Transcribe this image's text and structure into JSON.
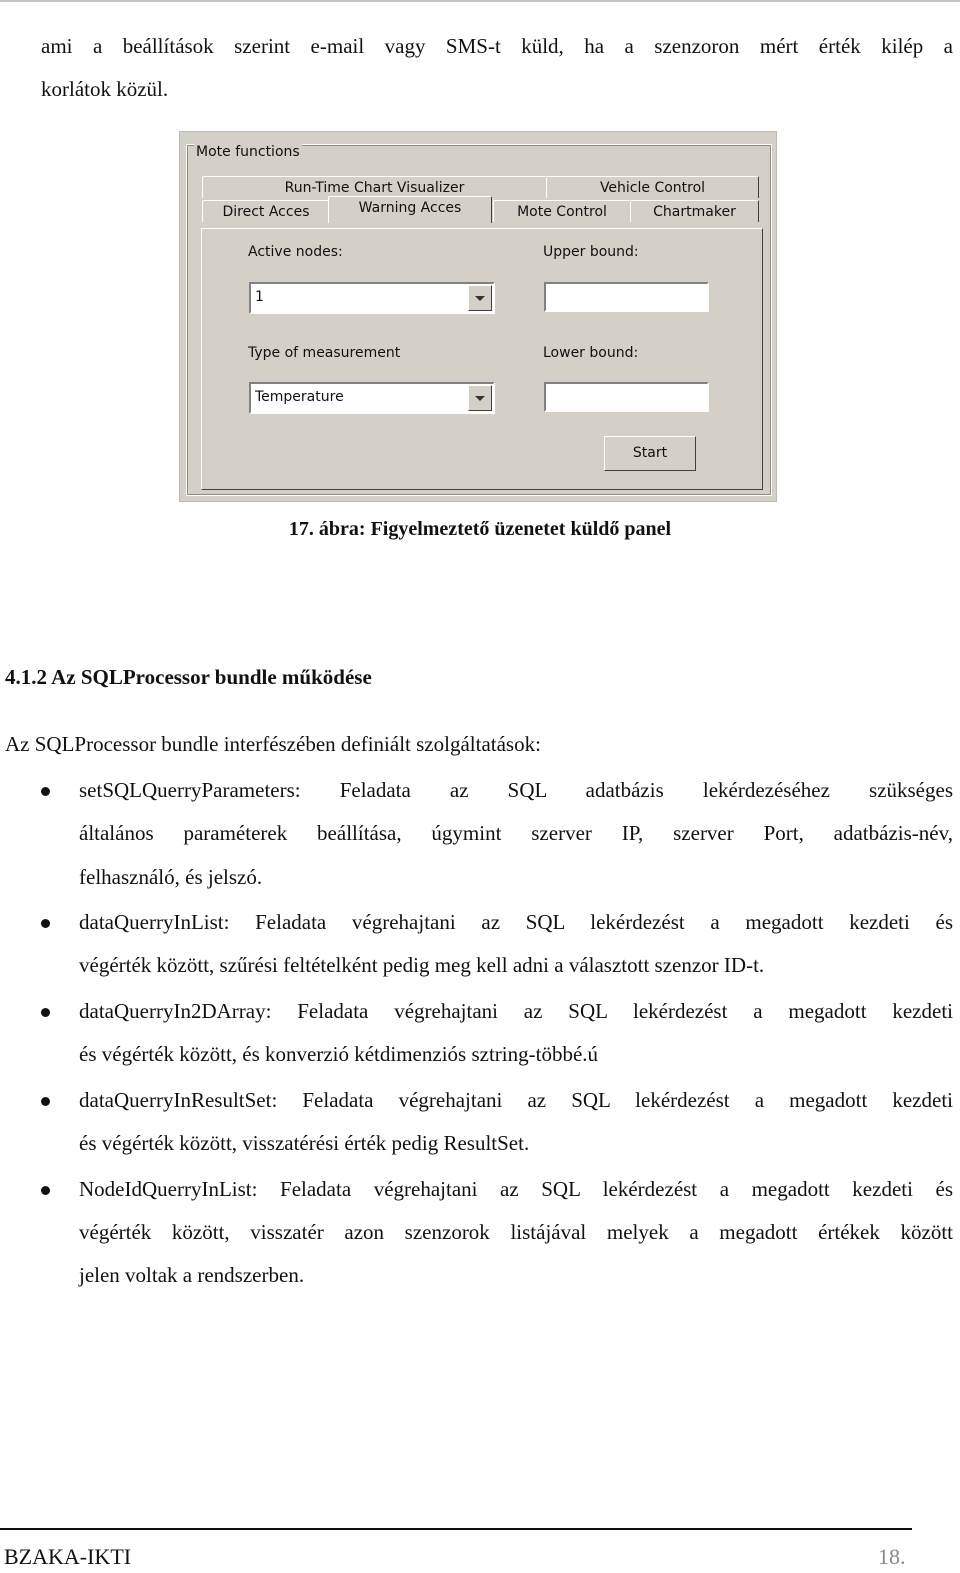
{
  "intro": {
    "line1": "ami a beállítások szerint e-mail vagy SMS-t küld, ha a szenzoron mért érték kilép a",
    "line2": "korlátok közül."
  },
  "panel": {
    "group_label": "Mote functions",
    "tabs_back_row": [
      "Run-Time Chart Visualizer",
      "Vehicle Control"
    ],
    "tabs_front_row": [
      "Direct Acces",
      "Warning Acces",
      "Mote Control",
      "Chartmaker"
    ],
    "active_tab": "Warning Acces",
    "active_nodes_label": "Active nodes:",
    "active_nodes_value": "1",
    "type_label": "Type of measurement",
    "type_value": "Temperature",
    "upper_label": "Upper bound:",
    "upper_value": "",
    "lower_label": "Lower bound:",
    "lower_value": "",
    "start_label": "Start"
  },
  "caption": "17.  ábra: Figyelmeztető üzenetet küldő panel",
  "section": {
    "heading": "4.1.2  Az SQLProcessor bundle működése",
    "intro": "Az SQLProcessor bundle interfészében definiált szolgáltatások:",
    "bullets": [
      {
        "lines": [
          "setSQLQuerryParameters: Feladata az SQL adatbázis lekérdezéséhez szükséges",
          "általános paraméterek beállítása, úgymint szerver IP, szerver Port, adatbázis-név,",
          "felhasználó, és jelszó."
        ]
      },
      {
        "lines": [
          "dataQuerryInList: Feladata végrehajtani az SQL lekérdezést a megadott kezdeti és",
          "végérték között, szűrési feltételként pedig meg kell adni a választott szenzor ID-t."
        ]
      },
      {
        "lines": [
          "dataQuerryIn2DArray: Feladata végrehajtani az SQL lekérdezést a megadott kezdeti",
          "és végérték között, és konverzió kétdimenziós sztring-többé.ú"
        ]
      },
      {
        "lines": [
          "dataQuerryInResultSet: Feladata végrehajtani az SQL lekérdezést a megadott kezdeti",
          "és végérték között, visszatérési érték pedig ResultSet."
        ]
      },
      {
        "lines": [
          "NodeIdQuerryInList: Feladata végrehajtani az SQL lekérdezést a megadott kezdeti és",
          "végérték között, visszatér azon szenzorok listájával melyek a megadott értékek között",
          "jelen voltak a rendszerben."
        ]
      }
    ]
  },
  "footer": {
    "left": "BZAKA-IKTI",
    "page": "18."
  }
}
